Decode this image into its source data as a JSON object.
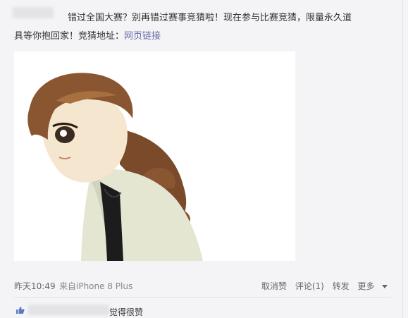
{
  "post": {
    "text_line1": "错过全国大赛？别再错过赛事竞猜啦！现在参与比赛竞猜，限量永久道",
    "text_line2": "具等你抱回家！竞猜地址：",
    "link_label": "网页链接"
  },
  "meta": {
    "time": "昨天10:49",
    "source": "来自iPhone 8 Plus"
  },
  "actions": {
    "unlike": "取消赞",
    "comment": "评论(1)",
    "forward": "转发",
    "more": "更多"
  },
  "likes": {
    "suffix": "觉得很赞"
  },
  "colors": {
    "link": "#6a6aa8",
    "like_icon": "#5b7cc5"
  }
}
